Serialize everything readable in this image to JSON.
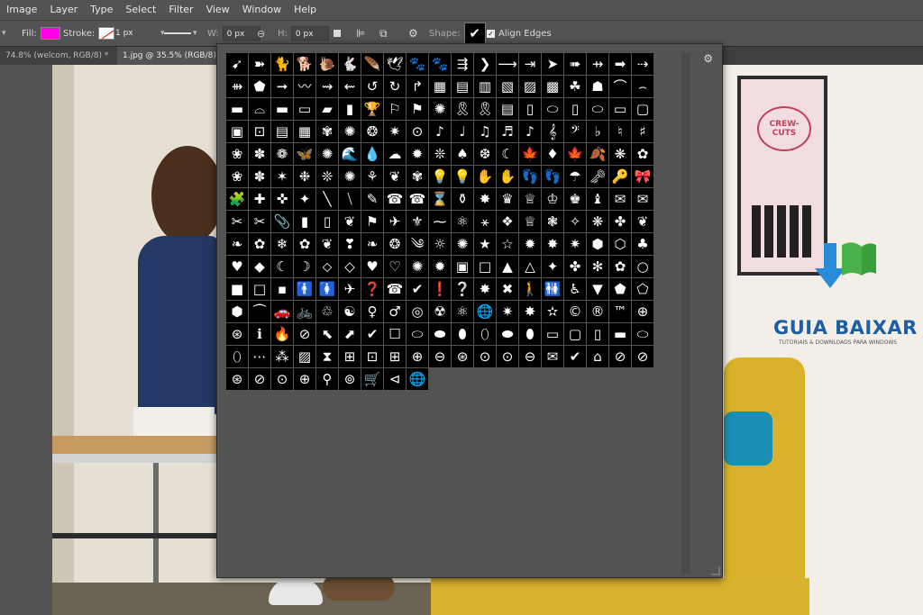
{
  "menu": {
    "items": [
      "Image",
      "Layer",
      "Type",
      "Select",
      "Filter",
      "View",
      "Window",
      "Help"
    ]
  },
  "options": {
    "fill_label": "Fill:",
    "fill_color": "#ff00e6",
    "stroke_label": "Stroke:",
    "stroke_width": "1 px",
    "w_label": "W:",
    "w_value": "0 px",
    "h_label": "H:",
    "h_value": "0 px",
    "shape_label": "Shape:",
    "shape_glyph": "✔",
    "align_edges_label": "Align Edges",
    "align_edges_checked": true
  },
  "tabs": [
    {
      "label": "74.8% (welcom, RGB/8) *",
      "active": false
    },
    {
      "label": "1.jpg @ 35.5% (RGB/8) *",
      "active": true
    }
  ],
  "canvas": {
    "poster_text": "CREW-CUTS",
    "logo_title": "GUIA BAIXAR",
    "logo_tagline": "TUTORIAIS & DOWNLOADS PARA WINDOWS"
  },
  "shape_picker": {
    "gear_icon": "gear-icon",
    "rows": [
      [
        "➹",
        "➽",
        "🐈",
        "🐕",
        "🐌",
        "🐇",
        "🪶",
        "🕊",
        "🐾",
        "🐾",
        "⇶",
        "❯",
        "⟶",
        "⇥",
        "➤",
        "➠",
        "⇸",
        "➡"
      ],
      [
        "⇢",
        "⇻",
        "⬟",
        "➞",
        "〰",
        "⇝",
        "⇜",
        "↺",
        "↻",
        "↱",
        "▦",
        "▤",
        "▥",
        "▧",
        "▨",
        "▩",
        "☘",
        "☗"
      ],
      [
        "⌒",
        "⌢",
        "▬",
        "⌓",
        "▬",
        "▭",
        "▰",
        "▮",
        "🏆",
        "⚐",
        "⚑",
        "✺",
        "🎗",
        "🎗",
        "▤",
        "▯",
        "⬭"
      ],
      [
        "▯",
        "⬭",
        "▭",
        "▢",
        "▣",
        "⊡",
        "▤",
        "▦",
        "✾",
        "✺",
        "❂",
        "✷",
        "⊙",
        "♪",
        "♩",
        "♫",
        "♬"
      ],
      [
        "♪",
        "𝄞",
        "𝄢",
        "♭",
        "♮",
        "♯",
        "❀",
        "✽",
        "❁",
        "🦋",
        "✺",
        "🌊",
        "💧",
        "☁",
        "✹",
        "❊",
        "♠"
      ],
      [
        "❆",
        "☾",
        "🍁",
        "♦",
        "🍁",
        "🍂",
        "❋",
        "✿",
        "❀",
        "✽",
        "✶",
        "❉",
        "❊",
        "✺",
        "⚘",
        "❦",
        "✾"
      ],
      [
        "💡",
        "💡",
        "✋",
        "✋",
        "👣",
        "👣",
        "☂",
        "🗝",
        "🔑",
        "🎀",
        "🧩",
        "✚",
        "✜",
        "✦",
        "╲",
        "⧹",
        "✎"
      ],
      [
        "☎",
        "☎",
        "⌛",
        "⚱",
        "✸",
        "♛",
        "♕",
        "♔",
        "♚",
        "♝",
        "✉",
        "✉",
        "✂",
        "✂",
        "📎",
        "▮",
        "▯"
      ],
      [
        "❦",
        "⚑",
        "✈",
        "⚜",
        "⁓",
        "⚛",
        "⚹",
        "❖",
        "♕",
        "❃",
        "✧",
        "❋",
        "✤",
        "❦",
        "❧",
        "✿",
        "❄"
      ],
      [
        "✿",
        "❦",
        "❣",
        "❧",
        "❂",
        "༄",
        "☼",
        "✺",
        "★",
        "☆",
        "✹",
        "✸",
        "✷",
        "⬢",
        "⬡",
        "♣",
        "♥"
      ],
      [
        "◆",
        "☾",
        "☽",
        "⬦",
        "◇",
        "♥",
        "♡",
        "✺",
        "✹",
        "▣",
        "□",
        "▲",
        "△",
        "✦",
        "✤",
        "✻",
        "✿"
      ],
      [
        "○",
        "■",
        "□",
        "▪",
        "🚹",
        "🚺",
        "✈",
        "❓",
        "☎",
        "✔",
        "❗",
        "❔",
        "✸",
        "✖",
        "🚶",
        "🚻",
        "♿"
      ],
      [
        "▼",
        "⬟",
        "⬠",
        "⬢",
        "⏜",
        "🚗",
        "🚲",
        "♲",
        "☯",
        "♀",
        "♂",
        "◎",
        "☢",
        "⚛",
        "🌐",
        "✷",
        "✸"
      ],
      [
        "✫",
        "©",
        "®",
        "™",
        "⊕",
        "⊛",
        "ℹ",
        "🔥",
        "⊘",
        "⬉",
        "⬈",
        "✔",
        "☐",
        "⬭",
        "⬬",
        "⬮",
        "⬯"
      ],
      [
        "⬬",
        "⬮",
        "▭",
        "▢",
        "▯",
        "▬",
        "⬭",
        "⬯",
        "⋯",
        "⁂",
        "▨",
        "⧗",
        "⊞",
        "⊡",
        "⊞",
        "⊕",
        "⊖"
      ],
      [
        "⊛",
        "⊙",
        "⊙",
        "⊖",
        "✉",
        "✔",
        "⌂",
        "⊘",
        "⊘",
        "⊛",
        "⊘",
        "⊙",
        "⊕",
        "⚲",
        "⊚",
        "🛒",
        "⊲"
      ],
      [
        "🌐"
      ]
    ]
  }
}
